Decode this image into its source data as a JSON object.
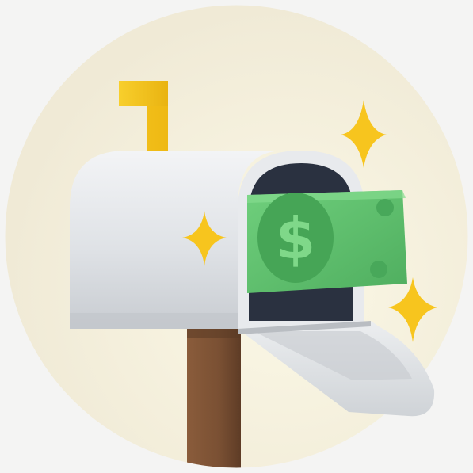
{
  "illustration": {
    "subject": "mailbox-with-money",
    "bill_symbol": "$",
    "flag_state": "raised",
    "door_state": "open",
    "sparkle_count": 3
  },
  "colors": {
    "page_background": "#f4f4f3",
    "circle_background": "#f7f2e0",
    "mailbox_body": "#dfe2e5",
    "mailbox_shadow": "#c3c7cc",
    "mailbox_interior": "#2a3140",
    "flag": "#f6c21a",
    "post": "#7a5033",
    "bill": "#5fbf6d",
    "bill_dark": "#3f9a51",
    "sparkle": "#f7c51e"
  }
}
